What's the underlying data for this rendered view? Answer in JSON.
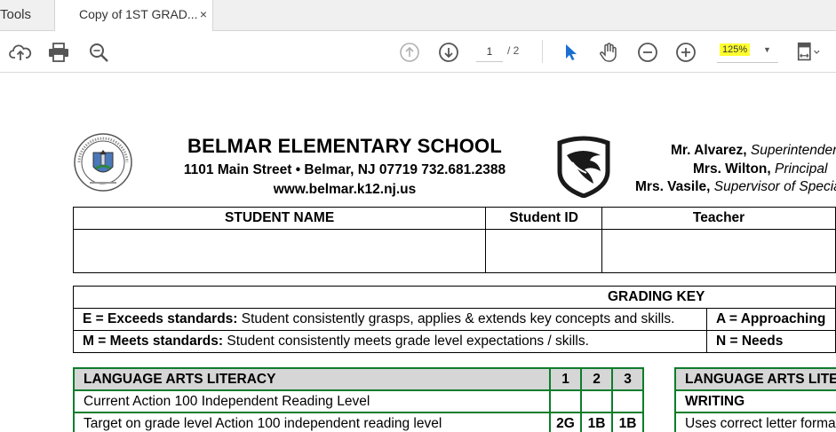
{
  "tabs": {
    "tools_label": "Tools",
    "doc_label": "Copy of 1ST GRAD...",
    "close_glyph": "×"
  },
  "toolbar": {
    "page_current": "1",
    "page_total": "/ 2",
    "zoom": "125%"
  },
  "school": {
    "name": "BELMAR ELEMENTARY SCHOOL",
    "address": "1101 Main Street • Belmar, NJ 07719 732.681.2388",
    "website": "www.belmar.k12.nj.us"
  },
  "staff": [
    {
      "name": "Mr. Alvarez,",
      "role": " Superintendent"
    },
    {
      "name": "Mrs. Wilton,",
      "role": " Principal"
    },
    {
      "name": "Mrs. Vasile,",
      "role": " Supervisor of Special Services"
    }
  ],
  "student_table": {
    "headers": [
      "STUDENT NAME",
      "Student ID",
      "Teacher"
    ]
  },
  "grading_key": {
    "title": "GRADING KEY",
    "rows": [
      {
        "term": "E = Exceeds standards:",
        "desc": " Student consistently grasps, applies & extends key concepts and skills.",
        "right_term": "A = Approaching"
      },
      {
        "term": "M = Meets standards:",
        "desc": " Student consistently meets grade level expectations / skills.",
        "right_term": "N = Needs"
      }
    ]
  },
  "language_arts": {
    "title": "LANGUAGE ARTS LITERACY",
    "terms": [
      "1",
      "2",
      "3"
    ],
    "rows": [
      {
        "label": "Current Action 100 Independent Reading Level",
        "values": [
          "",
          "",
          ""
        ]
      },
      {
        "label": "Target on grade level Action 100 independent reading level",
        "values": [
          "2G",
          "1B",
          "1B"
        ]
      }
    ]
  },
  "language_arts_right": {
    "title": "LANGUAGE ARTS LITERACY",
    "subheading": "WRITING",
    "row": "Uses correct letter formation"
  },
  "colors": {
    "table_border_green": "#0d7d2b",
    "zoom_highlight": "#ffff30",
    "cursor_blue": "#1a6fd0"
  }
}
